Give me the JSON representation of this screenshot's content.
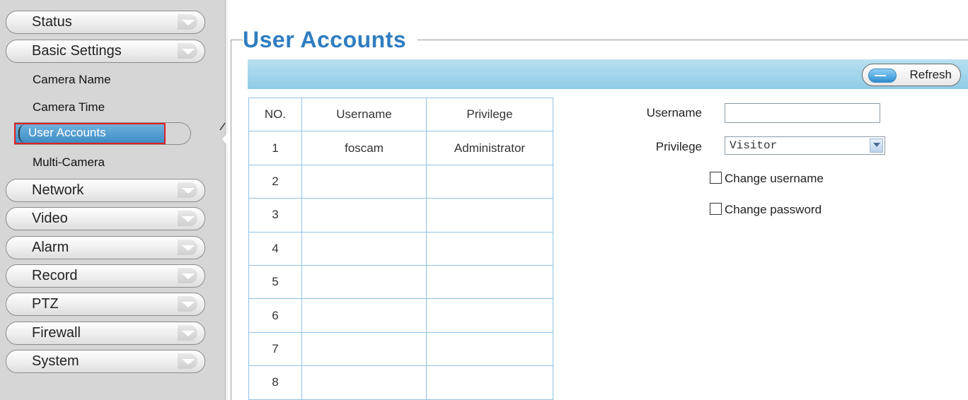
{
  "sidebar": {
    "menus": {
      "status": "Status",
      "basic_settings": "Basic Settings",
      "network": "Network",
      "video": "Video",
      "alarm": "Alarm",
      "record": "Record",
      "ptz": "PTZ",
      "firewall": "Firewall",
      "system": "System"
    },
    "sub_items": {
      "camera_name": "Camera Name",
      "camera_time": "Camera Time",
      "user_accounts": "User Accounts",
      "multi_camera": "Multi-Camera"
    },
    "selected": "User Accounts"
  },
  "main": {
    "title": "User Accounts",
    "toolbar": {
      "refresh_label": "Refresh"
    },
    "table": {
      "headers": [
        "NO.",
        "Username",
        "Privilege"
      ],
      "rows": [
        [
          "1",
          "foscam",
          "Administrator"
        ],
        [
          "2",
          "",
          ""
        ],
        [
          "3",
          "",
          ""
        ],
        [
          "4",
          "",
          ""
        ],
        [
          "5",
          "",
          ""
        ],
        [
          "6",
          "",
          ""
        ],
        [
          "7",
          "",
          ""
        ],
        [
          "8",
          "",
          ""
        ]
      ]
    },
    "form": {
      "username_label": "Username",
      "username_value": "",
      "privilege_label": "Privilege",
      "privilege_value": "Visitor",
      "change_username_label": "Change username",
      "change_password_label": "Change password"
    }
  },
  "colors": {
    "title": "#2f7dc0",
    "toolbar": "#a6d6ec",
    "selected_item": "#4a97cd",
    "highlight_box": "#e02020",
    "table_border": "#8fc3e6"
  }
}
